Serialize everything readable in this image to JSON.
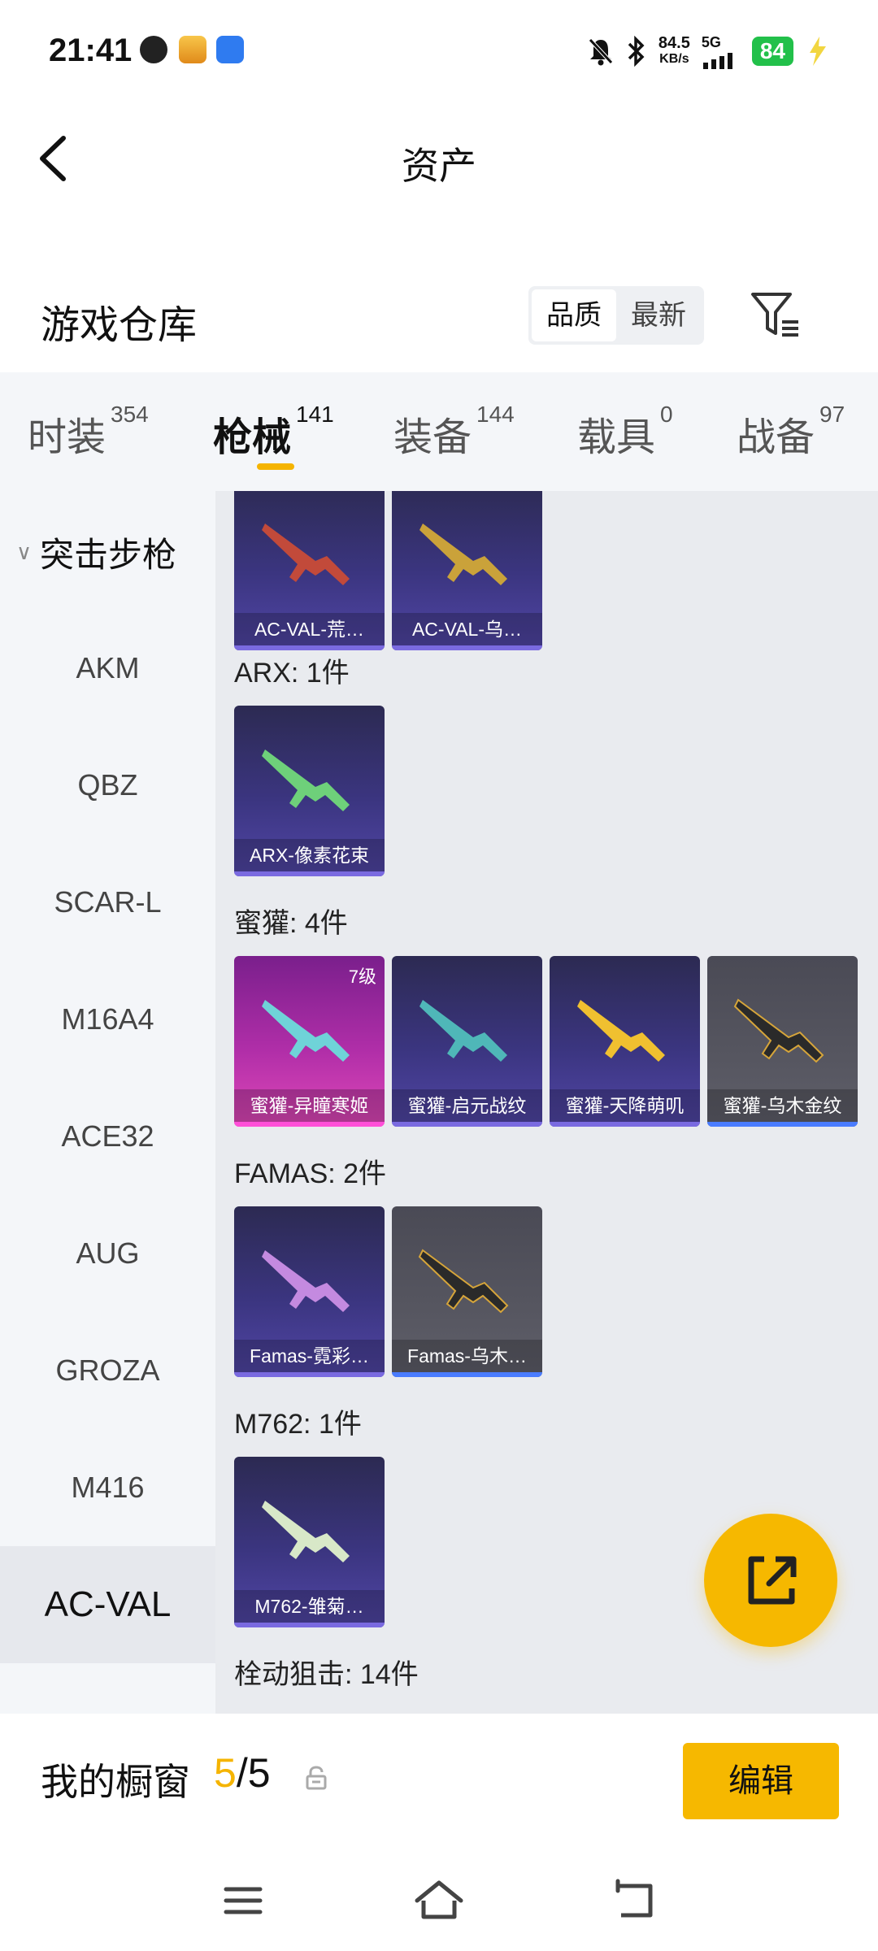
{
  "status_bar": {
    "time": "21:41",
    "net_speed_value": "84.5",
    "net_speed_unit": "KB/s",
    "net_type": "5G",
    "battery": "84",
    "notification_icons": [
      "browser-icon",
      "game-app-icon",
      "broadcast-app-icon"
    ]
  },
  "header": {
    "title": "资产"
  },
  "warehouse": {
    "title": "游戏仓库",
    "sort_options": [
      {
        "label": "品质",
        "active": true
      },
      {
        "label": "最新",
        "active": false
      }
    ]
  },
  "tabs": [
    {
      "label": "时装",
      "count": "354"
    },
    {
      "label": "枪械",
      "count": "141",
      "active": true
    },
    {
      "label": "装备",
      "count": "144"
    },
    {
      "label": "载具",
      "count": "0"
    },
    {
      "label": "战备",
      "count": "97"
    }
  ],
  "sidebar": {
    "group_label": "突击步枪",
    "items": [
      "AKM",
      "QBZ",
      "SCAR-L",
      "M16A4",
      "ACE32",
      "AUG",
      "GROZA",
      "M416",
      "AC-VAL"
    ],
    "active": "AC-VAL"
  },
  "groups": {
    "acval": {
      "cards": [
        {
          "label": "AC-VAL-荒…",
          "rarity": "purple"
        },
        {
          "label": "AC-VAL-乌…",
          "rarity": "purple"
        }
      ]
    },
    "arx": {
      "title": "ARX: 1件",
      "cards": [
        {
          "label": "ARX-像素花束",
          "rarity": "purple"
        }
      ]
    },
    "honey": {
      "title": "蜜獾: 4件",
      "cards": [
        {
          "label": "蜜獾-异瞳寒姬",
          "rarity": "pink",
          "level": "7级"
        },
        {
          "label": "蜜獾-启元战纹",
          "rarity": "purple"
        },
        {
          "label": "蜜獾-天降萌叽",
          "rarity": "purple"
        },
        {
          "label": "蜜獾-乌木金纹",
          "rarity": "gray"
        }
      ]
    },
    "famas": {
      "title": "FAMAS: 2件",
      "cards": [
        {
          "label": "Famas-霓彩…",
          "rarity": "purple"
        },
        {
          "label": "Famas-乌木…",
          "rarity": "gray"
        }
      ]
    },
    "m762": {
      "title": "M762: 1件",
      "cards": [
        {
          "label": "M762-雏菊…",
          "rarity": "purple"
        }
      ]
    },
    "sniper": {
      "title": "栓动狙击: 14件"
    }
  },
  "showcase": {
    "label": "我的橱窗",
    "current": "5",
    "separator": "/",
    "total": "5",
    "edit_label": "编辑"
  },
  "colors": {
    "accent": "#f6b800",
    "battery_green": "#22c04a",
    "card_purple": "#3b3580",
    "card_pink": "#b02ea8",
    "card_gray": "#565660"
  }
}
